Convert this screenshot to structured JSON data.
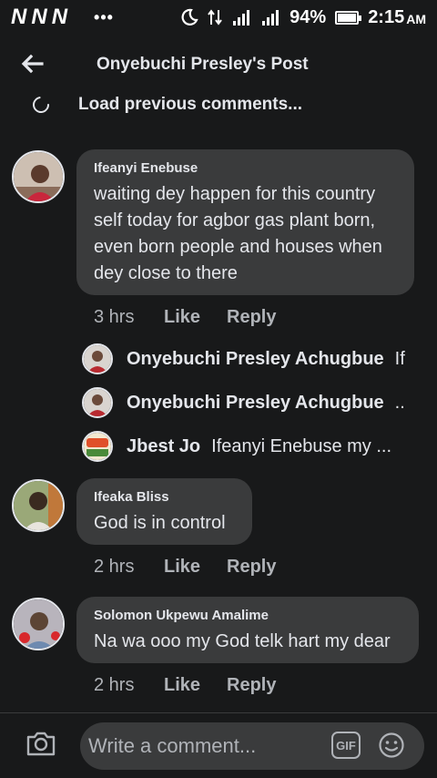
{
  "status_bar": {
    "notif_n1": "N",
    "notif_n2": "N",
    "notif_n3": "N",
    "more_dots": "•••",
    "battery_percent": "94%",
    "time": "2:15",
    "ampm": "AM"
  },
  "header": {
    "title": "Onyebuchi Presley's Post"
  },
  "load_previous": "Load previous comments...",
  "comments": [
    {
      "name": "Ifeanyi Enebuse",
      "lines": [
        "waiting dey happen for this country",
        "self today for agbor gas plant born,",
        "even born people and houses when",
        "dey close to there"
      ],
      "time": "3 hrs",
      "like": "Like",
      "reply": "Reply",
      "replies": [
        {
          "name": "Onyebuchi Presley Achugbue",
          "snippet": "If"
        },
        {
          "name": "Onyebuchi Presley Achugbue",
          "snippet": ".."
        },
        {
          "name": "Jbest Jo",
          "snippet": "Ifeanyi Enebuse my ..."
        }
      ]
    },
    {
      "name": "Ifeaka Bliss",
      "lines": [
        "God is in control"
      ],
      "time": "2 hrs",
      "like": "Like",
      "reply": "Reply"
    },
    {
      "name": "Solomon Ukpewu Amalime",
      "lines": [
        "Na wa ooo my God telk hart my dear"
      ],
      "time": "2 hrs",
      "like": "Like",
      "reply": "Reply"
    }
  ],
  "composer": {
    "placeholder": "Write a comment...",
    "gif_label": "GIF"
  },
  "icons": {
    "back": "arrow-left-icon",
    "spinner": "loading-spinner-icon",
    "camera": "camera-icon",
    "gif": "gif-icon",
    "emoji": "emoji-smile-icon"
  },
  "colors": {
    "background": "#18191a",
    "bubble": "#3a3b3c",
    "text_primary": "#e4e6eb",
    "text_secondary": "#b0b3b8"
  }
}
